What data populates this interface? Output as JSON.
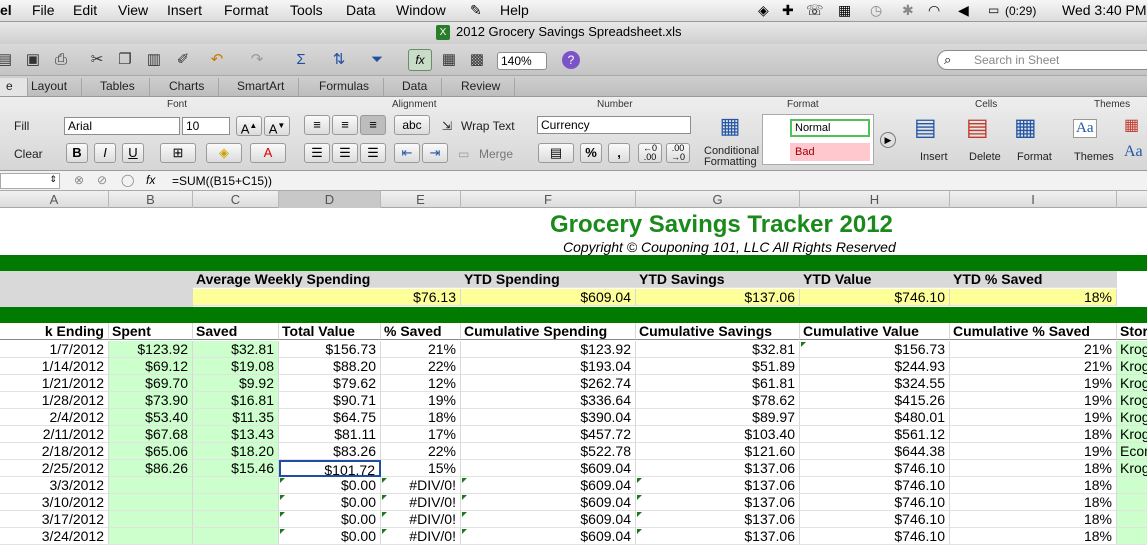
{
  "menubar": {
    "app": "el",
    "items": [
      "File",
      "Edit",
      "View",
      "Insert",
      "Format",
      "Tools",
      "Data",
      "Window",
      "Help"
    ],
    "battery": "(0:29)",
    "clock": "Wed 3:40 PM"
  },
  "window": {
    "title": "2012 Grocery Savings Spreadsheet.xls"
  },
  "toolbar": {
    "zoom": "140%",
    "search_placeholder": "Search in Sheet"
  },
  "ribbon": {
    "tabs": [
      "e",
      "Layout",
      "Tables",
      "Charts",
      "SmartArt",
      "Formulas",
      "Data",
      "Review"
    ],
    "groups": {
      "font": "Font",
      "alignment": "Alignment",
      "number": "Number",
      "format": "Format",
      "cells": "Cells",
      "themes": "Themes"
    },
    "fill": "Fill",
    "clear": "Clear",
    "font_name": "Arial",
    "font_size": "10",
    "wrap_text": "Wrap Text",
    "merge": "Merge",
    "number_format": "Currency",
    "conditional": "Conditional",
    "formatting": "Formatting",
    "style_normal": "Normal",
    "style_bad": "Bad",
    "insert": "Insert",
    "delete": "Delete",
    "format": "Format",
    "themes": "Themes",
    "aa": "Aa",
    "fx": "fx"
  },
  "formula": {
    "text": "=SUM((B15+C15))"
  },
  "columns": [
    "A",
    "B",
    "C",
    "D",
    "E",
    "F",
    "G",
    "H",
    "I"
  ],
  "sheet": {
    "title": "Grocery Savings Tracker 2012",
    "copyright": "Copyright © Couponing 101, LLC All Rights Reserved",
    "summary_headers": [
      "Average Weekly Spending",
      "YTD Spending",
      "YTD Savings",
      "YTD Value",
      "YTD % Saved"
    ],
    "summary_values": [
      "$76.13",
      "$609.04",
      "$137.06",
      "$746.10",
      "18%"
    ],
    "table_headers": [
      "k Ending",
      "Spent",
      "Saved",
      "Total Value",
      "% Saved",
      "Cumulative Spending",
      "Cumulative Savings",
      "Cumulative Value",
      "Cumulative % Saved",
      "Stor"
    ],
    "rows": [
      [
        "1/7/2012",
        "$123.92",
        "$32.81",
        "$156.73",
        "21%",
        "$123.92",
        "$32.81",
        "$156.73",
        "21%",
        "Krog"
      ],
      [
        "1/14/2012",
        "$69.12",
        "$19.08",
        "$88.20",
        "22%",
        "$193.04",
        "$51.89",
        "$244.93",
        "21%",
        "Krog"
      ],
      [
        "1/21/2012",
        "$69.70",
        "$9.92",
        "$79.62",
        "12%",
        "$262.74",
        "$61.81",
        "$324.55",
        "19%",
        "Krog"
      ],
      [
        "1/28/2012",
        "$73.90",
        "$16.81",
        "$90.71",
        "19%",
        "$336.64",
        "$78.62",
        "$415.26",
        "19%",
        "Krog"
      ],
      [
        "2/4/2012",
        "$53.40",
        "$11.35",
        "$64.75",
        "18%",
        "$390.04",
        "$89.97",
        "$480.01",
        "19%",
        "Krog"
      ],
      [
        "2/11/2012",
        "$67.68",
        "$13.43",
        "$81.11",
        "17%",
        "$457.72",
        "$103.40",
        "$561.12",
        "18%",
        "Krog"
      ],
      [
        "2/18/2012",
        "$65.06",
        "$18.20",
        "$83.26",
        "22%",
        "$522.78",
        "$121.60",
        "$644.38",
        "19%",
        "Econ"
      ],
      [
        "2/25/2012",
        "$86.26",
        "$15.46",
        "$101.72",
        "15%",
        "$609.04",
        "$137.06",
        "$746.10",
        "18%",
        "Krog"
      ],
      [
        "3/3/2012",
        "",
        "",
        "$0.00",
        "#DIV/0!",
        "$609.04",
        "$137.06",
        "$746.10",
        "18%",
        ""
      ],
      [
        "3/10/2012",
        "",
        "",
        "$0.00",
        "#DIV/0!",
        "$609.04",
        "$137.06",
        "$746.10",
        "18%",
        ""
      ],
      [
        "3/17/2012",
        "",
        "",
        "$0.00",
        "#DIV/0!",
        "$609.04",
        "$137.06",
        "$746.10",
        "18%",
        ""
      ],
      [
        "3/24/2012",
        "",
        "",
        "$0.00",
        "#DIV/0!",
        "$609.04",
        "$137.06",
        "$746.10",
        "18%",
        ""
      ]
    ]
  },
  "colors": {
    "accent_green": "#1a8a1a",
    "band_green": "#007a00",
    "input_green": "#ccffcc",
    "summary_yellow": "#ffff99"
  }
}
